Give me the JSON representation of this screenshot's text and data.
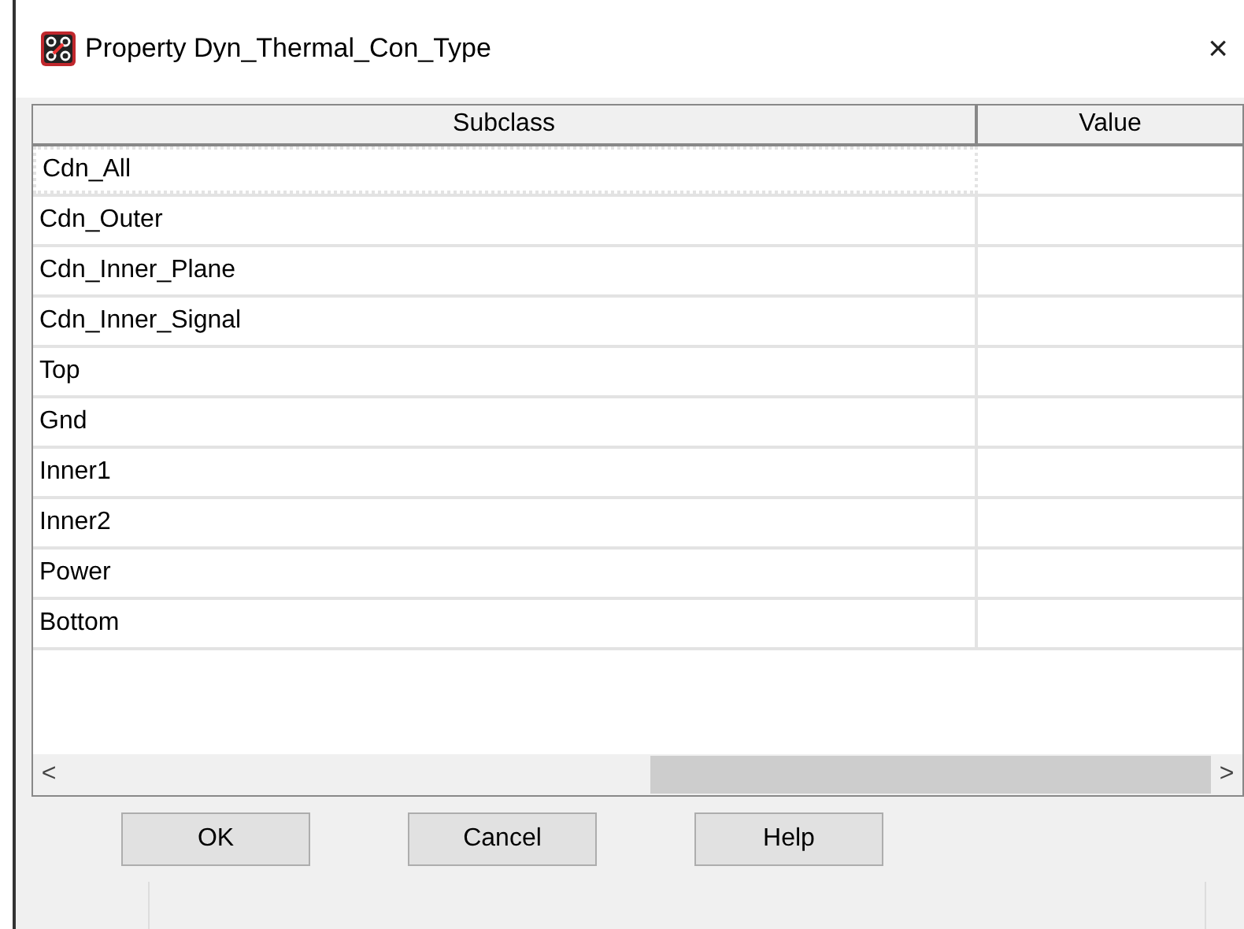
{
  "window": {
    "title": "Property Dyn_Thermal_Con_Type",
    "close": "×"
  },
  "table": {
    "columns": [
      "Subclass",
      "Value"
    ],
    "rows": [
      {
        "subclass": "Cdn_All",
        "selected": true
      },
      {
        "subclass": "Cdn_Outer",
        "selected": false
      },
      {
        "subclass": "Cdn_Inner_Plane",
        "selected": false
      },
      {
        "subclass": "Cdn_Inner_Signal",
        "selected": false
      },
      {
        "subclass": "Top",
        "selected": false
      },
      {
        "subclass": "Gnd",
        "selected": false
      },
      {
        "subclass": "Inner1",
        "selected": false
      },
      {
        "subclass": "Inner2",
        "selected": false
      },
      {
        "subclass": "Power",
        "selected": false
      },
      {
        "subclass": "Bottom",
        "selected": false
      }
    ]
  },
  "scrollbar": {
    "left": "<",
    "right": ">"
  },
  "buttons": [
    "OK",
    "Cancel",
    "Help"
  ]
}
